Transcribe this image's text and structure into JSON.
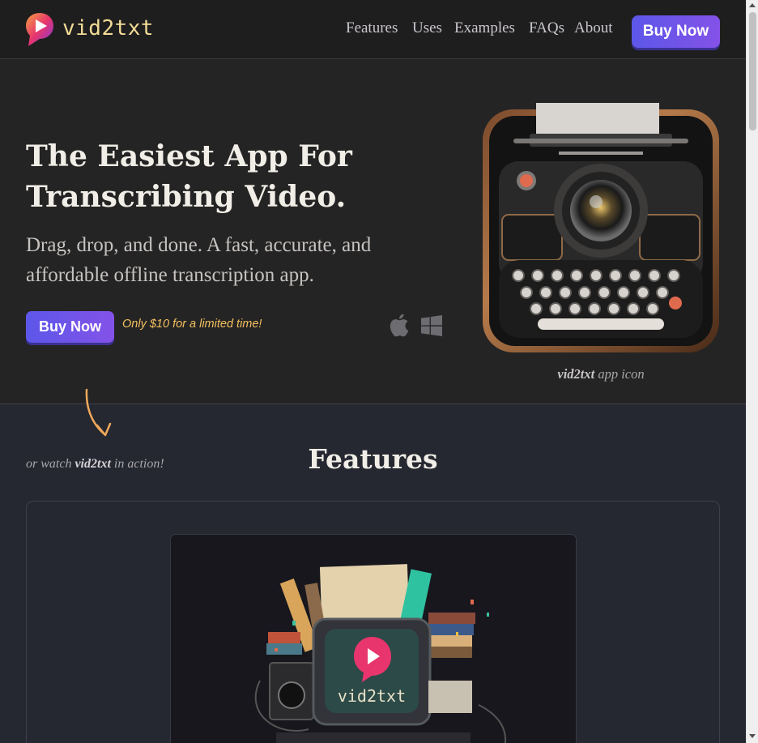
{
  "brand": {
    "name": "vid2txt"
  },
  "nav": {
    "items": [
      "Features",
      "Uses",
      "Examples",
      "FAQs",
      "About"
    ],
    "buy_label": "Buy Now"
  },
  "hero": {
    "title_line1": "The Easiest App For",
    "title_line2": "Transcribing Video.",
    "subtitle_line1": "Drag, drop, and done. A fast, accurate, and",
    "subtitle_line2": "affordable offline transcription app.",
    "buy_label": "Buy Now",
    "promo": "Only $10 for a limited time!",
    "platform_icons": [
      "apple-icon",
      "windows-icon"
    ],
    "icon_caption_bold": "vid2txt",
    "icon_caption_rest": " app icon"
  },
  "features": {
    "watch_prefix": "or watch ",
    "watch_bold": "vid2txt",
    "watch_suffix": " in action!",
    "title": "Features",
    "video_brand": "vid2txt"
  },
  "colors": {
    "accent_start": "#5c57e9",
    "accent_end": "#8452e8",
    "brand_text": "#f2dc96",
    "promo_text": "#f3c05f"
  }
}
